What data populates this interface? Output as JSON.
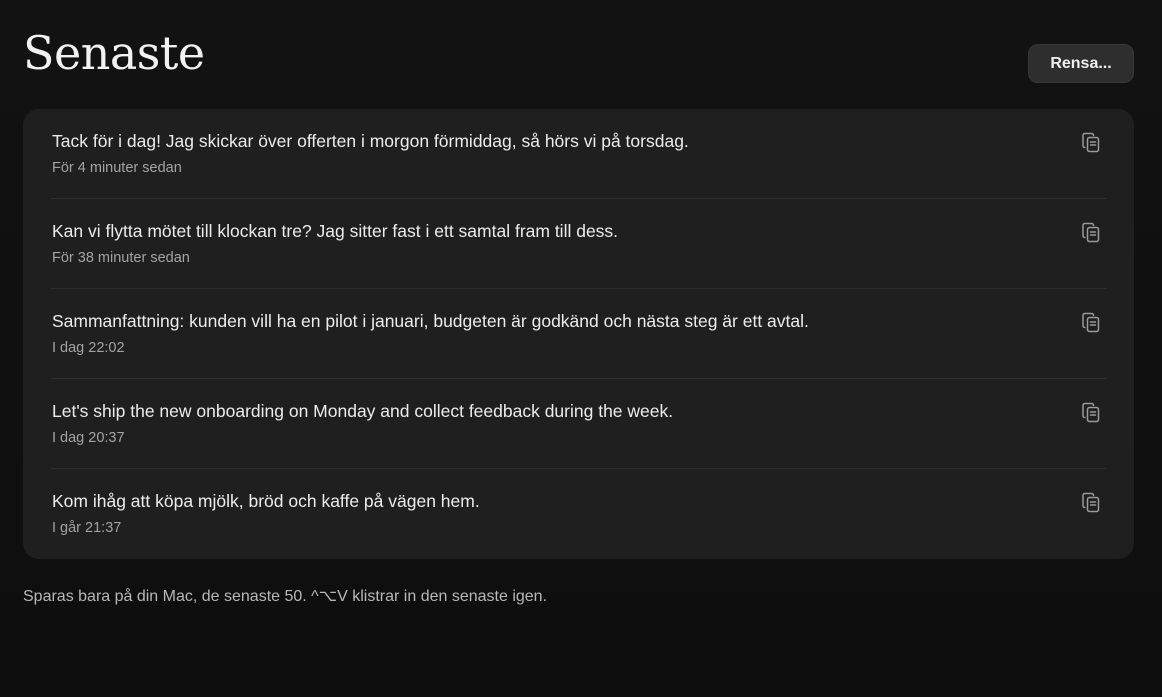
{
  "header": {
    "title": "Senaste",
    "clear_label": "Rensa..."
  },
  "history": {
    "items": [
      {
        "text": "Tack för i dag! Jag skickar över offerten i morgon förmiddag, så hörs vi på torsdag.",
        "time": "För 4 minuter sedan",
        "icon": "copy-icon"
      },
      {
        "text": "Kan vi flytta mötet till klockan tre? Jag sitter fast i ett samtal fram till dess.",
        "time": "För 38 minuter sedan",
        "icon": "copy-icon"
      },
      {
        "text": "Sammanfattning: kunden vill ha en pilot i januari, budgeten är godkänd och nästa steg är ett avtal.",
        "time": "I dag 22:02",
        "icon": "copy-icon"
      },
      {
        "text": "Let's ship the new onboarding on Monday and collect feedback during the week.",
        "time": "I dag 20:37",
        "icon": "copy-icon"
      },
      {
        "text": "Kom ihåg att köpa mjölk, bröd och kaffe på vägen hem.",
        "time": "I går 21:37",
        "icon": "copy-icon"
      }
    ]
  },
  "footer": {
    "note": "Sparas bara på din Mac, de senaste 50. ^⌥V klistrar in den senaste igen."
  }
}
